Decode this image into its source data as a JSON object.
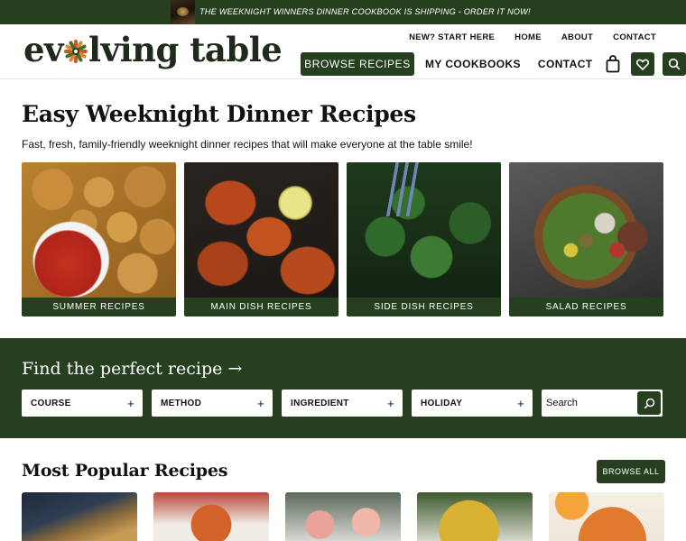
{
  "banner": {
    "promo_prefix": "THE ",
    "promo_book": "WEEKNIGHT WINNERS DINNER COOKBOOK",
    "promo_suffix": " IS SHIPPING - ORDER IT NOW!"
  },
  "brand": {
    "logo_left": "ev",
    "logo_right": "lving table",
    "color_primary": "#26401f"
  },
  "topnav": [
    "NEW? START HERE",
    "HOME",
    "ABOUT",
    "CONTACT"
  ],
  "mainnav": {
    "browse": "BROWSE RECIPES",
    "cookbooks": "MY COOKBOOKS",
    "contact": "CONTACT",
    "icons": [
      "shopping-bag-icon",
      "heart-icon",
      "search-icon"
    ]
  },
  "hero": {
    "title": "Easy Weeknight Dinner Recipes",
    "subtitle": "Fast, fresh, family-friendly weeknight dinner recipes that will make everyone at the table smile!",
    "cards": [
      {
        "label": "SUMMER RECIPES"
      },
      {
        "label": "MAIN DISH RECIPES"
      },
      {
        "label": "SIDE DISH RECIPES"
      },
      {
        "label": "SALAD RECIPES"
      }
    ]
  },
  "finder": {
    "title": "Find the perfect recipe →",
    "filters": [
      "COURSE",
      "METHOD",
      "INGREDIENT",
      "HOLIDAY"
    ],
    "plus": "+",
    "search_placeholder": "Search"
  },
  "popular": {
    "title": "Most Popular Recipes",
    "browse_all": "BROWSE ALL"
  }
}
